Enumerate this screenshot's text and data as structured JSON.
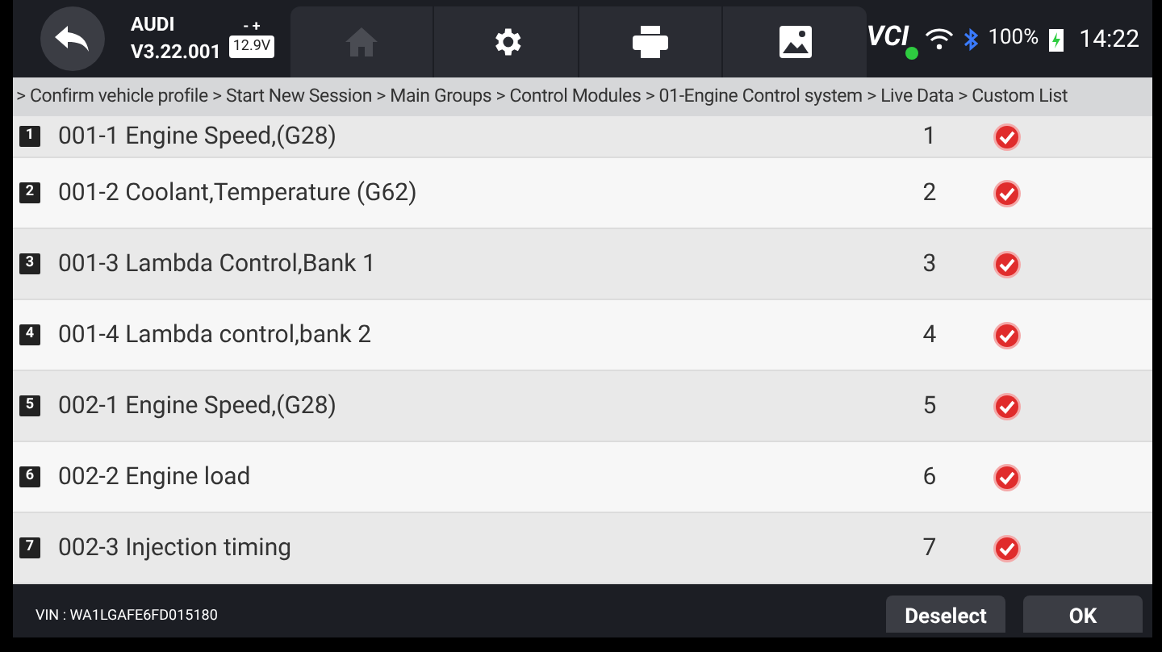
{
  "header": {
    "brand": "AUDI",
    "version": "V3.22.001",
    "battery_voltage": "12.9V",
    "battery_signs": "- +",
    "toolbar": [
      {
        "kind": "home",
        "disabled": true
      },
      {
        "kind": "settings",
        "disabled": false
      },
      {
        "kind": "print",
        "disabled": false
      },
      {
        "kind": "image",
        "disabled": false
      }
    ],
    "status": {
      "vci": "VCI",
      "battery": "100%",
      "time": "14:22"
    }
  },
  "breadcrumb": "> Confirm vehicle profile > Start New Session > Main Groups > Control Modules > 01-Engine Control system > Live Data > Custom List",
  "rows": [
    {
      "badge": "1",
      "label": "001-1 Engine Speed,(G28)",
      "number": "1",
      "checked": true
    },
    {
      "badge": "2",
      "label": "001-2 Coolant,Temperature (G62)",
      "number": "2",
      "checked": true
    },
    {
      "badge": "3",
      "label": "001-3 Lambda Control,Bank 1",
      "number": "3",
      "checked": true
    },
    {
      "badge": "4",
      "label": "001-4 Lambda control,bank 2",
      "number": "4",
      "checked": true
    },
    {
      "badge": "5",
      "label": "002-1 Engine Speed,(G28)",
      "number": "5",
      "checked": true
    },
    {
      "badge": "6",
      "label": "002-2 Engine load",
      "number": "6",
      "checked": true
    },
    {
      "badge": "7",
      "label": "002-3 Injection timing",
      "number": "7",
      "checked": true
    }
  ],
  "footer": {
    "vin": "VIN : WA1LGAFE6FD015180",
    "buttons": [
      "Deselect",
      "OK"
    ]
  }
}
